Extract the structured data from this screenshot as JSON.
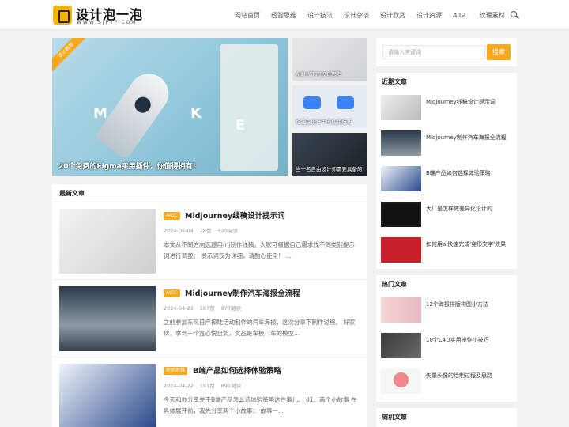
{
  "header": {
    "logo_title": "设计泡一泡",
    "logo_sub": "WWW.SJPYP.COM",
    "nav": [
      "网站首页",
      "经验思维",
      "设计技法",
      "设计杂谈",
      "设计欣赏",
      "设计资源",
      "AIGC",
      "纹理素材"
    ]
  },
  "slider": {
    "ribbon": "设计教程",
    "caption": "20个免费的Figma实用插件，你值得拥有！",
    "letters": [
      "M",
      "K",
      "E"
    ],
    "side": [
      {
        "caption": "AI时代下的设计思考"
      },
      {
        "caption": "按钮在设计中的使用技巧"
      },
      {
        "caption": "当一名自由设计师需要具备的"
      }
    ]
  },
  "latest": {
    "title": "最新文章",
    "posts": [
      {
        "tag": "AIGC",
        "title": "Midjourney线稿设计提示词",
        "date": "2024-06-04",
        "likes": "78赞",
        "reads": "520阅读",
        "desc": "本文从不同方向选题用mj制作线稿。大家可根据自己需求找不同类别提示词进行调整。 提示词仅为详细，请酌心使用！ ..."
      },
      {
        "tag": "AIGC",
        "title": "Midjourney制作汽车海报全流程",
        "date": "2024-04-23",
        "likes": "187赞",
        "reads": "877阅读",
        "desc": "之前参加东风日产探陆活动制作的汽车海报，这次分享下制作过程。 好家伙，拿到一个宽心悦目奖，奖品是车模（车的模型..."
      },
      {
        "tag": "经验思维",
        "title": "B端产品如何选择体验策略",
        "date": "2024-04-22",
        "likes": "191赞",
        "reads": "691阅读",
        "desc": "今天和你分享关于B端产品怎么选体验策略这件事儿。 01、两个小故事 在具体展开前，我先分享两个小故事： 故事一..."
      }
    ]
  },
  "sidebar": {
    "search_placeholder": "请输入关键词",
    "search_button": "搜索",
    "recent_title": "近期文章",
    "recent": [
      "Midjourney线稿设计提示词",
      "Midjourney制作汽车海报全流程",
      "B端产品如何选择体验策略",
      "大厂是怎样做差异化设计的",
      "如何用ai快速完成'变形文字'效果"
    ],
    "hot_title": "热门文章",
    "hot": [
      "12个海报排版构图小方法",
      "10个C4D实用操作小技巧",
      "矢量头像的绘制过程及思路"
    ],
    "random_title": "随机文章"
  },
  "colors": {
    "accent": "#f7a81b"
  }
}
